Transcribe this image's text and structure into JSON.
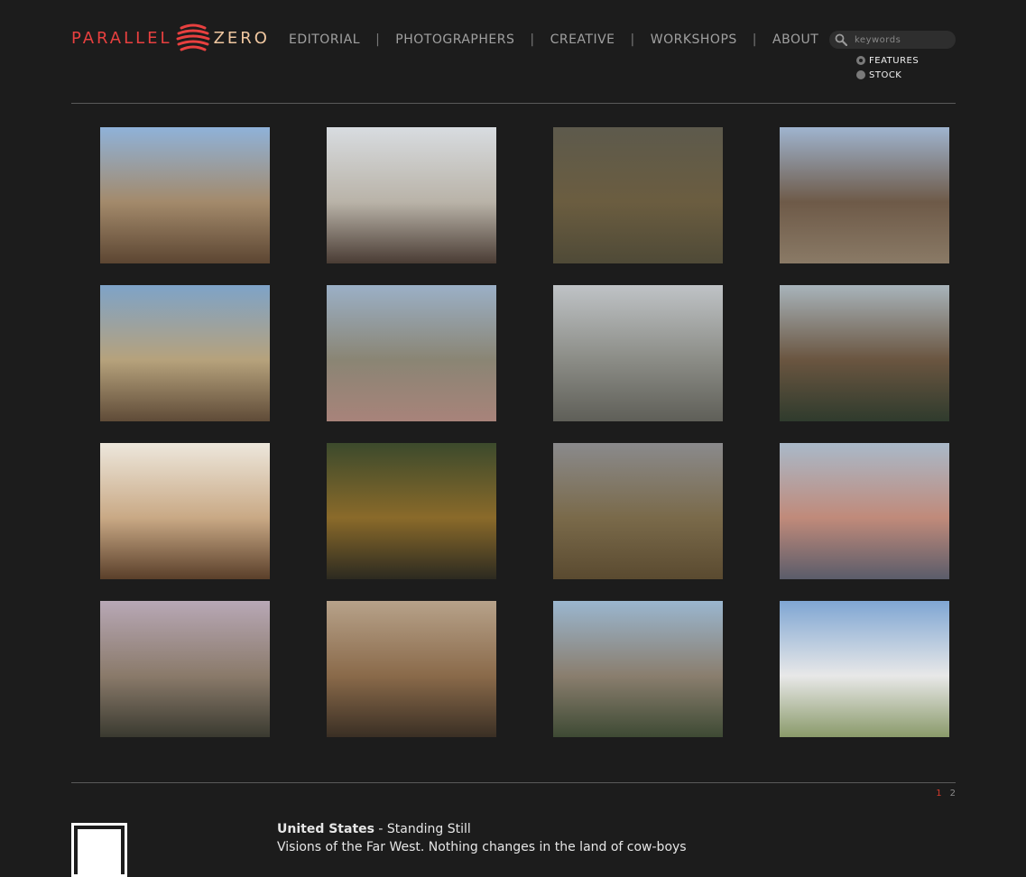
{
  "logo": {
    "left": "PARALLEL",
    "right": "ZERO",
    "accent": "#e8403f"
  },
  "nav": [
    "EDITORIAL",
    "PHOTOGRAPHERS",
    "CREATIVE",
    "WORKSHOPS",
    "ABOUT"
  ],
  "search": {
    "placeholder": "keywords"
  },
  "search_options": [
    {
      "label": "FEATURES",
      "selected": true
    },
    {
      "label": "STOCK",
      "selected": false
    }
  ],
  "thumbnails": [
    {
      "name": "thumb-mountain-cabin",
      "colors": [
        "#8fb2d9",
        "#a38a6b",
        "#5c4632"
      ]
    },
    {
      "name": "thumb-cafe-interior",
      "colors": [
        "#d8dce0",
        "#b9b3a8",
        "#4a3c34"
      ]
    },
    {
      "name": "thumb-pine-forest",
      "colors": [
        "#5d5a4c",
        "#6b5d40",
        "#4f4a37"
      ]
    },
    {
      "name": "thumb-roadside-shop",
      "colors": [
        "#9fb4cf",
        "#6e5a48",
        "#8a7a66"
      ]
    },
    {
      "name": "thumb-desert-town",
      "colors": [
        "#7ea3c8",
        "#b6a27c",
        "#5f4b38"
      ]
    },
    {
      "name": "thumb-skatepark",
      "colors": [
        "#9bb0c7",
        "#8a8574",
        "#a8837a"
      ]
    },
    {
      "name": "thumb-grandstand",
      "colors": [
        "#bfc3c6",
        "#8b8c86",
        "#5f5f58"
      ]
    },
    {
      "name": "thumb-mountain-valley",
      "colors": [
        "#a8b4bb",
        "#6a5540",
        "#2f3b2d"
      ]
    },
    {
      "name": "thumb-man-with-photo",
      "colors": [
        "#ede7dc",
        "#c9a985",
        "#5a3f2a"
      ]
    },
    {
      "name": "thumb-flag-autumn",
      "colors": [
        "#3c4a2c",
        "#8a6a2a",
        "#2c2a20"
      ]
    },
    {
      "name": "thumb-prairie-dusk",
      "colors": [
        "#8a8a8c",
        "#7a6a4a",
        "#5a4a30"
      ]
    },
    {
      "name": "thumb-airshow-crowd",
      "colors": [
        "#a9b9c9",
        "#c08a7a",
        "#5a5c6a"
      ]
    },
    {
      "name": "thumb-drive-in",
      "colors": [
        "#b8a8b6",
        "#8a7a6a",
        "#3a3a30"
      ]
    },
    {
      "name": "thumb-diner",
      "colors": [
        "#b7a28a",
        "#8a6a4a",
        "#3a2f24"
      ]
    },
    {
      "name": "thumb-hillside-town",
      "colors": [
        "#9ab6cf",
        "#8a7e6e",
        "#3e4a34"
      ]
    },
    {
      "name": "thumb-water-tower",
      "colors": [
        "#7fa6d3",
        "#e8e8e8",
        "#8a9a6a"
      ]
    }
  ],
  "pagination": {
    "current": "1",
    "other": "2"
  },
  "feature": {
    "title": "United States",
    "separator": " - ",
    "subtitle": "Standing Still",
    "description": "Visions of the Far West. Nothing changes in the land of cow-boys"
  }
}
